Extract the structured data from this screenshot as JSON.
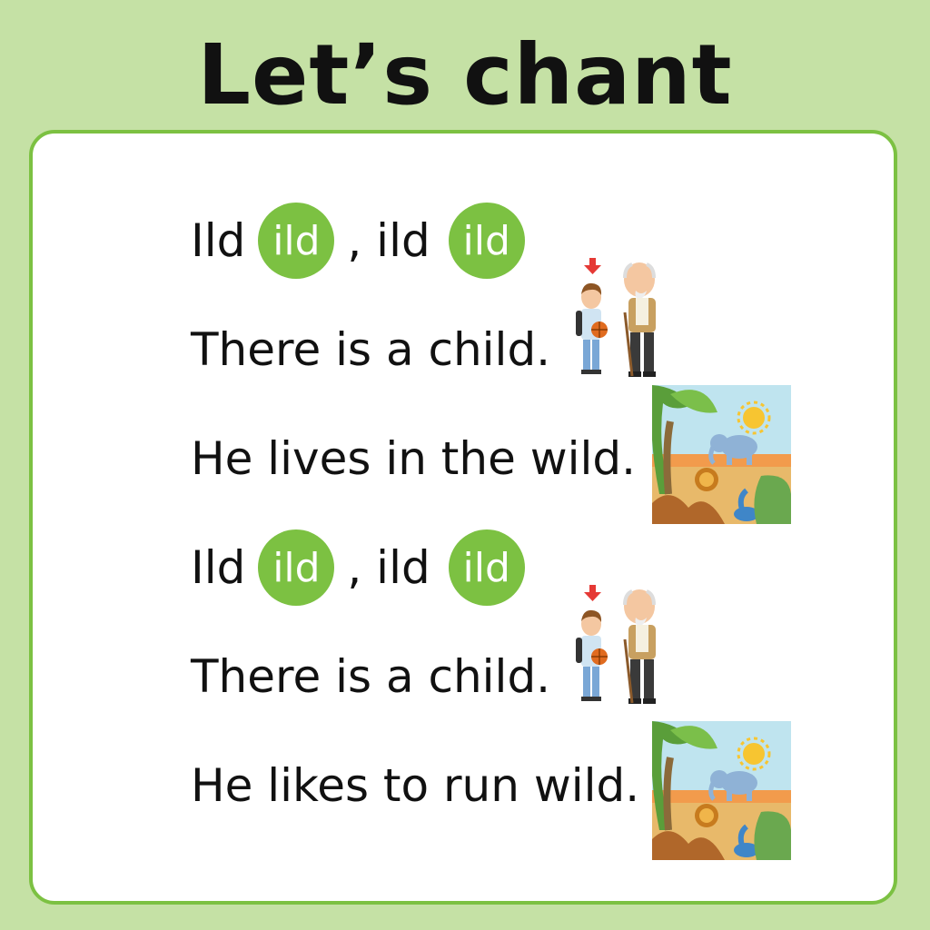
{
  "title": "Let’s chant",
  "chant": {
    "line1": {
      "word": "Ild",
      "bubble1": "ild",
      "sep": ", ild",
      "bubble2": "ild"
    },
    "line2": "There is a child.",
    "line3": "He lives in the wild.",
    "line4": {
      "word": "Ild",
      "bubble1": "ild",
      "sep": ", ild",
      "bubble2": "ild"
    },
    "line5": "There is a child.",
    "line6": "He likes to run wild."
  },
  "colors": {
    "background": "#c5e1a5",
    "accent": "#7cc142",
    "card": "#ffffff",
    "text": "#111111"
  },
  "icons": [
    "child-with-grandfather-illustration",
    "wild-jungle-illustration"
  ]
}
